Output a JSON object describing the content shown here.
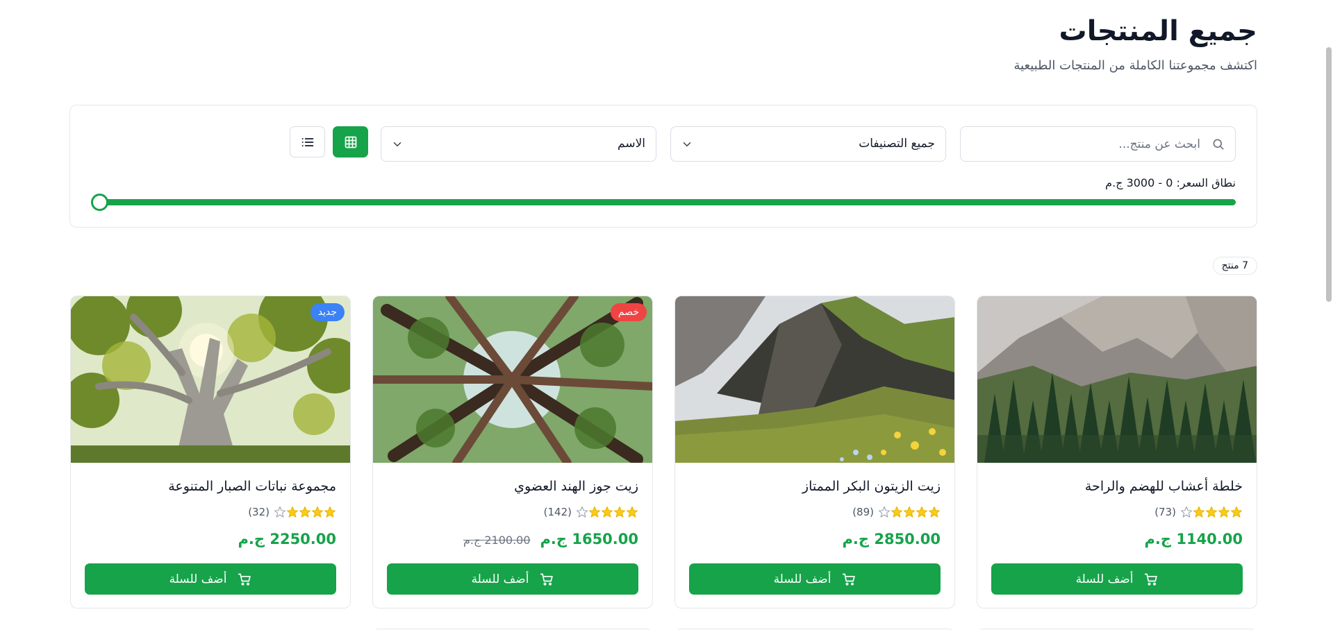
{
  "header": {
    "title": "جميع المنتجات",
    "subtitle": "اكتشف مجموعتنا الكاملة من المنتجات الطبيعية"
  },
  "filters": {
    "search_placeholder": "ابحث عن منتج...",
    "search_value": "",
    "category_value": "جميع التصنيفات",
    "sort_value": "الاسم",
    "price_label": "نطاق السعر: 0 - 3000 ج.م",
    "price_min": 0,
    "price_max": 3000,
    "active_view": "grid"
  },
  "results": {
    "count_label": "7 منتج"
  },
  "products": [
    {
      "title": "خلطة أعشاب للهضم والراحة",
      "rating": 4,
      "reviews": "(73)",
      "price": "1140.00 ج.م",
      "old_price": "",
      "badge": "",
      "badge_type": "",
      "image": "granite-cliff-forest",
      "add_label": "أضف للسلة"
    },
    {
      "title": "زيت الزيتون البكر الممتاز",
      "rating": 4,
      "reviews": "(89)",
      "price": "2850.00 ج.م",
      "old_price": "",
      "badge": "",
      "badge_type": "",
      "image": "mountain-meadow",
      "add_label": "أضف للسلة"
    },
    {
      "title": "زيت جوز الهند العضوي",
      "rating": 4,
      "reviews": "(142)",
      "price": "1650.00 ج.م",
      "old_price": "2100.00 ج.م",
      "badge": "خصم",
      "badge_type": "sale",
      "image": "tall-trees-upward",
      "add_label": "أضف للسلة"
    },
    {
      "title": "مجموعة نباتات الصبار المتنوعة",
      "rating": 4,
      "reviews": "(32)",
      "price": "2250.00 ج.م",
      "old_price": "",
      "badge": "جديد",
      "badge_type": "new",
      "image": "sunlit-tree",
      "add_label": "أضف للسلة"
    }
  ],
  "colors": {
    "primary": "#16a34a",
    "badge_new": "#3b82f6",
    "badge_sale": "#ef4444",
    "star": "#facc15",
    "border": "#e5e7eb"
  },
  "icons": {
    "search": "search-icon",
    "chevron": "chevron-down-icon",
    "grid": "grid-icon",
    "list": "list-icon",
    "cart": "cart-icon",
    "star": "star-icon"
  }
}
